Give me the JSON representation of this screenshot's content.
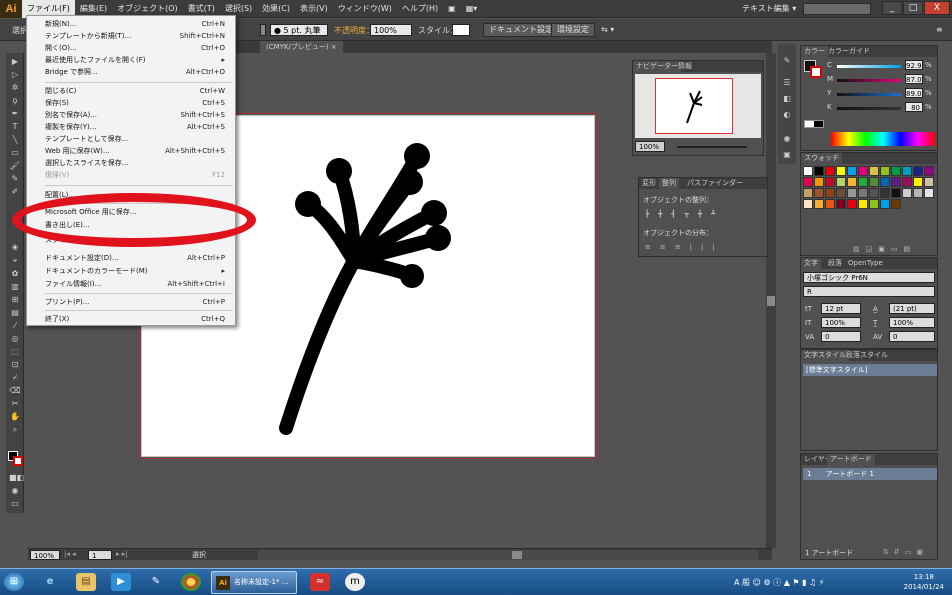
{
  "app": {
    "logo": "Ai"
  },
  "menubar": {
    "items": [
      "ファイル(F)",
      "編集(E)",
      "オブジェクト(O)",
      "書式(T)",
      "選択(S)",
      "効果(C)",
      "表示(V)",
      "ウィンドウ(W)",
      "ヘルプ(H)"
    ],
    "workspace": "テキスト編集",
    "window_controls": [
      "_",
      "□",
      "X"
    ]
  },
  "controlbar": {
    "left_label": "選択",
    "stroke_size": "5 pt. 丸筆",
    "opacity_label": "不透明度：",
    "opacity_value": "100%",
    "style_label": "スタイル：",
    "doc_setup": "ドキュメント設定",
    "prefs": "環境設定"
  },
  "doc_tab": {
    "title": "(CMYK/プレビュー)",
    "close": "×"
  },
  "file_menu": {
    "items": [
      {
        "label": "新規(N)...",
        "shortcut": "Ctrl+N"
      },
      {
        "label": "テンプレートから新規(T)...",
        "shortcut": "Shift+Ctrl+N"
      },
      {
        "label": "開く(O)...",
        "shortcut": "Ctrl+O"
      },
      {
        "label": "最近使用したファイルを開く(F)",
        "shortcut": "▸"
      },
      {
        "label": "Bridge で参照...",
        "shortcut": "Alt+Ctrl+O"
      },
      {
        "label": "閉じる(C)",
        "shortcut": "Ctrl+W"
      },
      {
        "label": "保存(S)",
        "shortcut": "Ctrl+S"
      },
      {
        "label": "別名で保存(A)...",
        "shortcut": "Shift+Ctrl+S"
      },
      {
        "label": "複製を保存(Y)...",
        "shortcut": "Alt+Ctrl+S"
      },
      {
        "label": "テンプレートとして保存...",
        "shortcut": ""
      },
      {
        "label": "Web 用に保存(W)...",
        "shortcut": "Alt+Shift+Ctrl+S"
      },
      {
        "label": "選択したスライスを保存...",
        "shortcut": ""
      },
      {
        "label": "復帰(V)",
        "shortcut": "F12"
      },
      {
        "label": "配置(L)...",
        "shortcut": ""
      },
      {
        "label": "Microsoft Office 用に保存...",
        "shortcut": ""
      },
      {
        "label": "書き出し(E)...",
        "shortcut": ""
      },
      {
        "label": "スクリプト(R)",
        "shortcut": ""
      },
      {
        "label": "ドキュメント設定(D)...",
        "shortcut": "Alt+Ctrl+P"
      },
      {
        "label": "ドキュメントのカラーモード(M)",
        "shortcut": "▸"
      },
      {
        "label": "ファイル情報(I)...",
        "shortcut": "Alt+Shift+Ctrl+I"
      },
      {
        "label": "プリント(P)...",
        "shortcut": "Ctrl+P"
      },
      {
        "label": "終了(X)",
        "shortcut": "Ctrl+Q"
      }
    ]
  },
  "navigator": {
    "tabs": [
      "ナビゲーター",
      "情報"
    ],
    "zoom": "100%"
  },
  "align": {
    "tabs": [
      "変形",
      "整列",
      "パスファインダー"
    ],
    "align_label": "オブジェクトの整列：",
    "distribute_label": "オブジェクトの分布："
  },
  "color": {
    "tabs": [
      "カラー",
      "カラーガイド"
    ],
    "channels": [
      {
        "name": "C",
        "value": "92.9",
        "unit": "%"
      },
      {
        "name": "M",
        "value": "87.0",
        "unit": "%"
      },
      {
        "name": "Y",
        "value": "89.0",
        "unit": "%"
      },
      {
        "name": "K",
        "value": "80",
        "unit": "%"
      }
    ]
  },
  "swatches": {
    "tab": "スウォッチ",
    "colors": [
      "#fff",
      "#000",
      "#e60012",
      "#ff0",
      "#00a0e9",
      "#e4007f",
      "#d7c447",
      "#8fc31f",
      "#009944",
      "#00a0c1",
      "#1d2088",
      "#920783",
      "#e5004f",
      "#f39800",
      "#c30d23",
      "#b3d465",
      "#f8b62d",
      "#22ac38",
      "#4f8d3a",
      "#0068b7",
      "#601986",
      "#a40b5d",
      "#fff100",
      "#d1c0a5",
      "#c9a063",
      "#a0522d",
      "#8b4513",
      "#6b4e3a",
      "#999",
      "#777",
      "#555",
      "#333",
      "#111",
      "#ccc",
      "#b5b5b5",
      "#e6e6e6",
      "#fce2c4",
      "#f6ad3c",
      "#ea5514",
      "#7d0022",
      "#e60012",
      "#ffe600",
      "#8fc31f",
      "#00a0e9",
      "#6a3906"
    ]
  },
  "character": {
    "tabs": [
      "文字",
      "段落",
      "OpenType"
    ],
    "font_family": "小塚ゴシック Pr6N",
    "font_style": "R",
    "font_size": "12 pt",
    "leading": "(21 pt)",
    "vscale": "100%",
    "hscale": "100%",
    "kerning": "0",
    "tracking": "0"
  },
  "char_styles": {
    "tabs": [
      "文字スタイル",
      "段落スタイル"
    ],
    "item": "[標準文字スタイル]"
  },
  "layers": {
    "tabs": [
      "レイヤー",
      "アートボード"
    ],
    "row_num": "1",
    "row_name": "アートボード 1",
    "footer": "1 アートボード"
  },
  "statusbar": {
    "zoom": "100%",
    "page": "1",
    "tool": "選択"
  },
  "taskbar": {
    "task_label": "名称未設定-1* ...",
    "time": "13:18",
    "date": "2014/01/24",
    "tray_text": "A 般"
  }
}
